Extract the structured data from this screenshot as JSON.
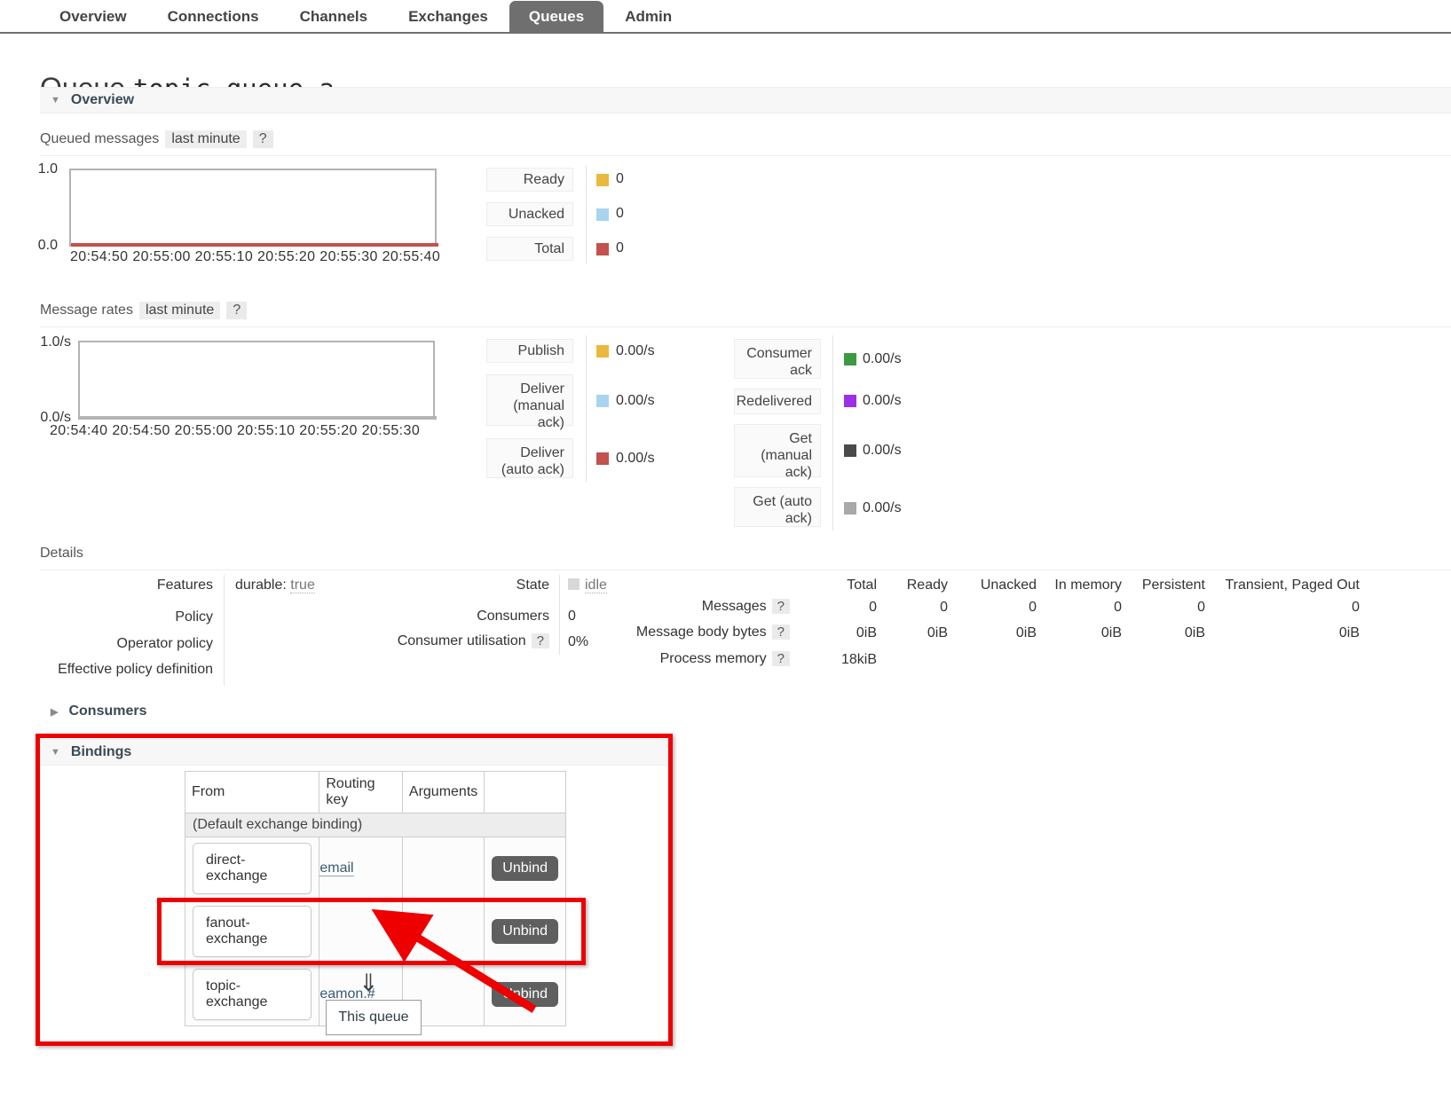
{
  "nav": {
    "items": [
      {
        "label": "Overview",
        "active": false
      },
      {
        "label": "Connections",
        "active": false
      },
      {
        "label": "Channels",
        "active": false
      },
      {
        "label": "Exchanges",
        "active": false
      },
      {
        "label": "Queues",
        "active": true
      },
      {
        "label": "Admin",
        "active": false
      }
    ]
  },
  "page": {
    "title_prefix": "Queue",
    "queue_name": "topic.queue.a"
  },
  "sections": {
    "overview": "Overview",
    "details": "Details",
    "consumers": "Consumers",
    "bindings": "Bindings"
  },
  "queued_messages": {
    "label": "Queued messages",
    "period": "last minute",
    "help": "?",
    "y_top": "1.0",
    "y_bottom": "0.0",
    "x_ticks": "20:54:50 20:55:00 20:55:10 20:55:20 20:55:30 20:55:40",
    "legend": [
      {
        "name": "Ready",
        "value": "0",
        "color": "#e8b93c"
      },
      {
        "name": "Unacked",
        "value": "0",
        "color": "#a8d4f0"
      },
      {
        "name": "Total",
        "value": "0",
        "color": "#c3514e"
      }
    ]
  },
  "message_rates": {
    "label": "Message rates",
    "period": "last minute",
    "help": "?",
    "y_top": "1.0/s",
    "y_bottom": "0.0/s",
    "x_ticks": "20:54:40 20:54:50 20:55:00 20:55:10 20:55:20 20:55:30",
    "legend_left": [
      {
        "name": "Publish",
        "value": "0.00/s",
        "color": "#e8b93c"
      },
      {
        "name": "Deliver (manual ack)",
        "value": "0.00/s",
        "color": "#a8d4f0"
      },
      {
        "name": "Deliver (auto ack)",
        "value": "0.00/s",
        "color": "#c3514e"
      }
    ],
    "legend_right": [
      {
        "name": "Consumer ack",
        "value": "0.00/s",
        "color": "#3c9a40"
      },
      {
        "name": "Redelivered",
        "value": "0.00/s",
        "color": "#9b30e8"
      },
      {
        "name": "Get (manual ack)",
        "value": "0.00/s",
        "color": "#4a4a4a"
      },
      {
        "name": "Get (auto ack)",
        "value": "0.00/s",
        "color": "#a9a9a9"
      }
    ]
  },
  "details": {
    "left": [
      {
        "label": "Features",
        "value": "durable: true"
      },
      {
        "label": "Policy",
        "value": ""
      },
      {
        "label": "Operator policy",
        "value": ""
      },
      {
        "label": "Effective policy definition",
        "value": ""
      }
    ],
    "features_key": "durable:",
    "features_val": "true",
    "middle": [
      {
        "label": "State",
        "value": "idle",
        "has_box": true,
        "help": false
      },
      {
        "label": "Consumers",
        "value": "0",
        "has_box": false,
        "help": false
      },
      {
        "label": "Consumer utilisation",
        "value": "0%",
        "has_box": false,
        "help": true
      }
    ],
    "table": {
      "columns": [
        "Total",
        "Ready",
        "Unacked",
        "In memory",
        "Persistent",
        "Transient, Paged Out"
      ],
      "rows": [
        {
          "label": "Messages",
          "help": "?",
          "values": [
            "0",
            "0",
            "0",
            "0",
            "0",
            "0"
          ]
        },
        {
          "label": "Message body bytes",
          "help": "?",
          "values": [
            "0iB",
            "0iB",
            "0iB",
            "0iB",
            "0iB",
            "0iB"
          ]
        },
        {
          "label": "Process memory",
          "help": "?",
          "values": [
            "18kiB",
            "",
            "",
            "",
            "",
            ""
          ]
        }
      ]
    }
  },
  "bindings": {
    "columns": [
      "From",
      "Routing key",
      "Arguments",
      ""
    ],
    "default_row": "(Default exchange binding)",
    "rows": [
      {
        "from": "direct-exchange",
        "routing_key": "email",
        "arguments": "",
        "action": "Unbind",
        "highlighted": false
      },
      {
        "from": "fanout-exchange",
        "routing_key": "",
        "arguments": "",
        "action": "Unbind",
        "highlighted": false
      },
      {
        "from": "topic-exchange",
        "routing_key": "eamon.#",
        "arguments": "",
        "action": "Unbind",
        "highlighted": true
      }
    ],
    "arrow_glyph": "⇓",
    "this_queue": "This queue"
  },
  "annotations": {
    "highlight_color": "#ee0000",
    "outer_box_label": "bindings-section-highlight",
    "inner_box_label": "topic-exchange-binding-highlight",
    "pointer_label": "routing-key-pointer"
  }
}
